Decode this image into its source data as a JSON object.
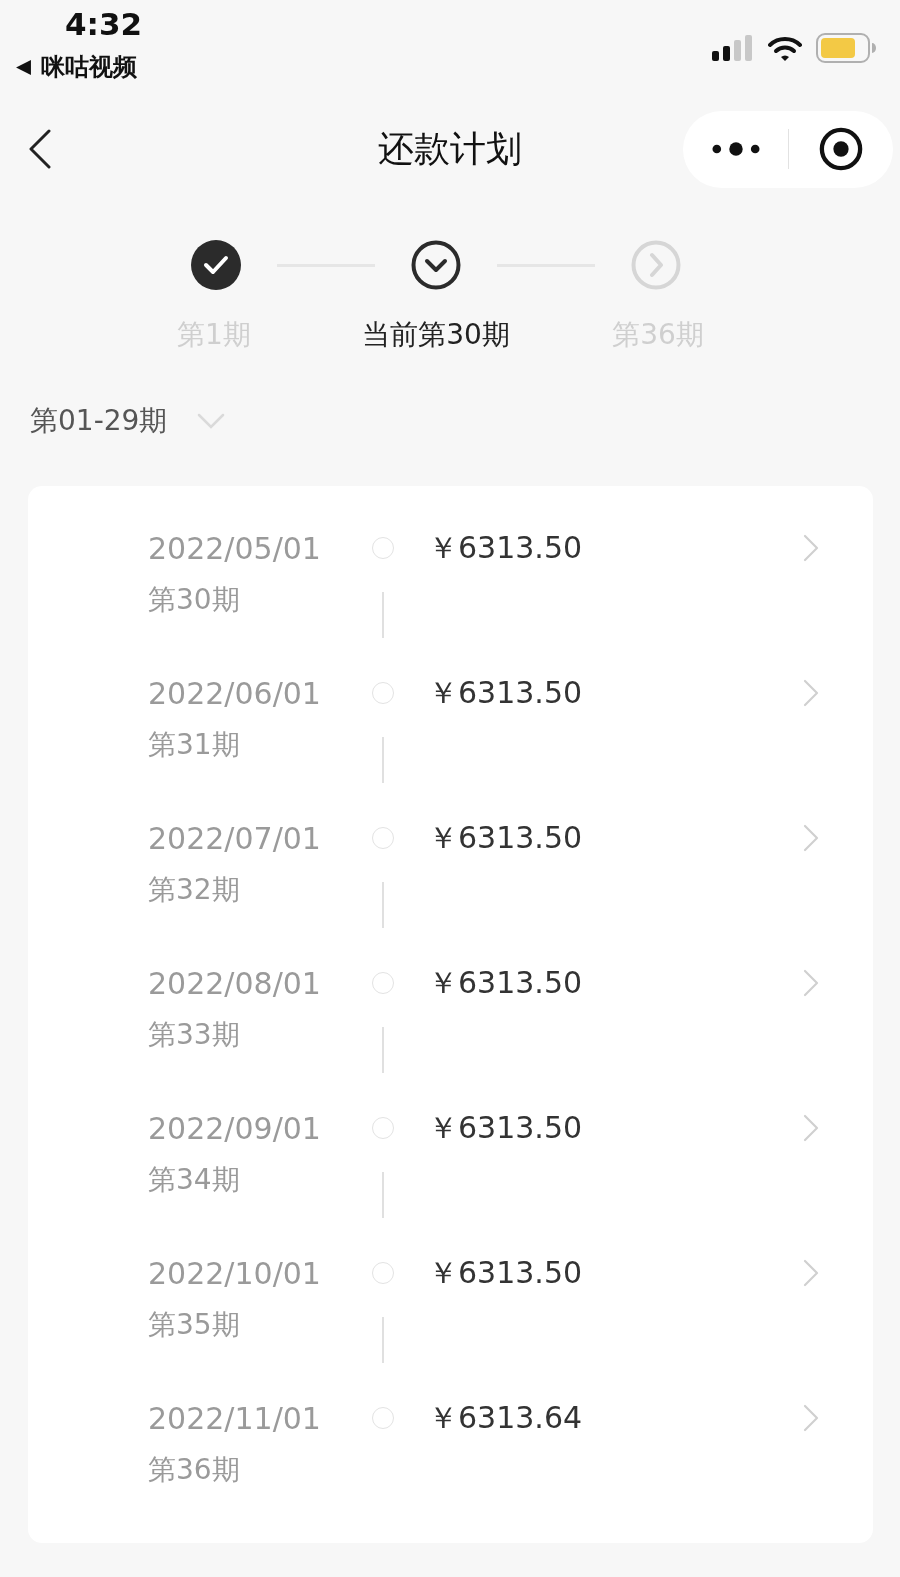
{
  "status_bar": {
    "time": "4:32",
    "back_app": "咪咕视频"
  },
  "nav": {
    "title": "还款计划"
  },
  "steps": [
    {
      "label": "第1期",
      "kind": "done"
    },
    {
      "label": "当前第30期",
      "kind": "current"
    },
    {
      "label": "第36期",
      "kind": "upcoming"
    }
  ],
  "range_filter": {
    "label": "第01-29期",
    "expanded": false
  },
  "installments": [
    {
      "date": "2022/05/01",
      "period": "第30期",
      "amount": "￥6313.50"
    },
    {
      "date": "2022/06/01",
      "period": "第31期",
      "amount": "￥6313.50"
    },
    {
      "date": "2022/07/01",
      "period": "第32期",
      "amount": "￥6313.50"
    },
    {
      "date": "2022/08/01",
      "period": "第33期",
      "amount": "￥6313.50"
    },
    {
      "date": "2022/09/01",
      "period": "第34期",
      "amount": "￥6313.50"
    },
    {
      "date": "2022/10/01",
      "period": "第35期",
      "amount": "￥6313.50"
    },
    {
      "date": "2022/11/01",
      "period": "第36期",
      "amount": "￥6313.64"
    }
  ]
}
